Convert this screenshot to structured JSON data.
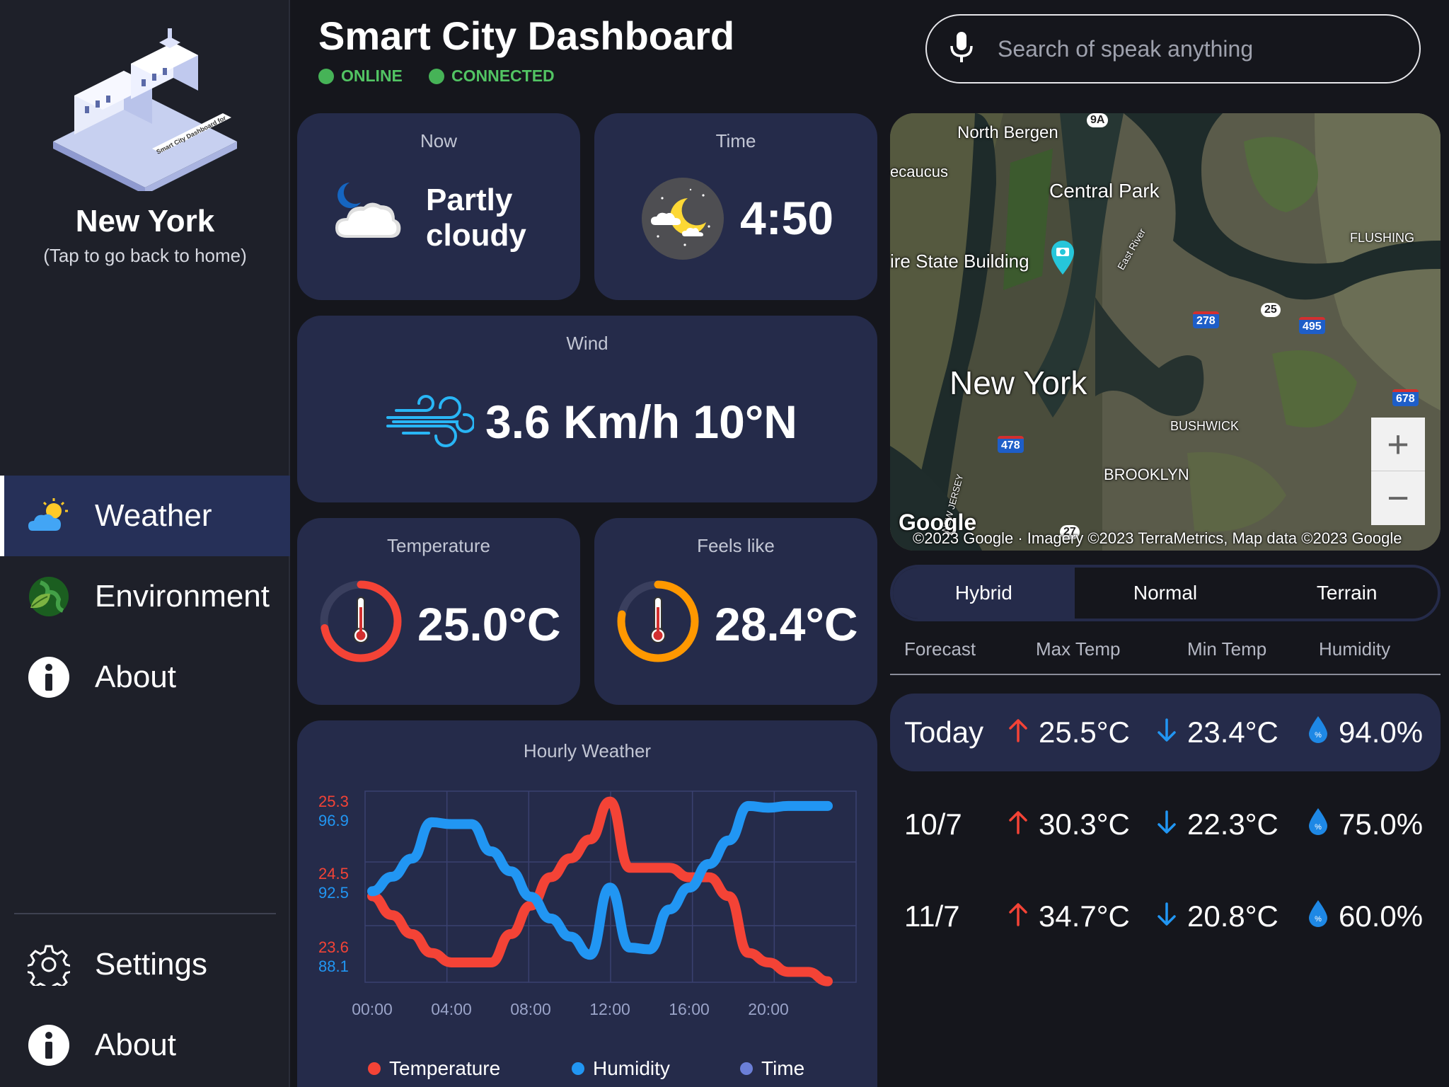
{
  "sidebar": {
    "city": "New York",
    "city_hint": "(Tap to go back to home)",
    "illustration_text": "Smart City Dashboard for",
    "nav": [
      {
        "label": "Weather",
        "icon": "weather-icon",
        "active": true
      },
      {
        "label": "Environment",
        "icon": "globe-leaf-icon"
      },
      {
        "label": "About",
        "icon": "info-icon"
      }
    ],
    "bottom": [
      {
        "label": "Settings",
        "icon": "gear-icon"
      },
      {
        "label": "About",
        "icon": "info-icon"
      }
    ]
  },
  "header": {
    "title": "Smart City Dashboard",
    "status_online": "ONLINE",
    "status_connected": "CONNECTED",
    "search_placeholder": "Search of speak anything"
  },
  "cards": {
    "now": {
      "title": "Now",
      "line1": "Partly",
      "line2": "cloudy",
      "icon": "partly-cloudy-night-icon"
    },
    "time": {
      "title": "Time",
      "value": "4:50",
      "icon": "moon-cloud-icon"
    },
    "wind": {
      "title": "Wind",
      "value": "3.6 Km/h 10°N",
      "icon": "wind-icon"
    },
    "temperature": {
      "title": "Temperature",
      "value": "25.0°C",
      "gauge_fraction": 0.72,
      "color": "#f44336"
    },
    "feels_like": {
      "title": "Feels like",
      "value": "28.4°C",
      "gauge_fraction": 0.78,
      "color": "#ff9800"
    }
  },
  "map": {
    "labels": {
      "north_bergen": "North Bergen",
      "secaucus": "ecaucus",
      "central_park": "Central Park",
      "empire": "ire State Building",
      "flushing": "FLUSHING",
      "east_river": "East River",
      "new_york": "New York",
      "bushwick": "BUSHWICK",
      "brooklyn": "BROOKLYN",
      "new_jersey": "NEW JERSEY"
    },
    "highways": {
      "h9a": "9A",
      "h278": "278",
      "h25": "25",
      "h495": "495",
      "h678": "678",
      "h478": "478",
      "h27": "27"
    },
    "logo": "Google",
    "attribution": "©2023 Google · Imagery ©2023 TerraMetrics, Map data ©2023 Google",
    "zoom_in": "+",
    "zoom_out": "−",
    "modes": [
      "Hybrid",
      "Normal",
      "Terrain"
    ],
    "active_mode": "Hybrid"
  },
  "forecast": {
    "headers": [
      "Forecast",
      "Max Temp",
      "Min Temp",
      "Humidity"
    ],
    "rows": [
      {
        "day": "Today",
        "max": "25.5°C",
        "min": "23.4°C",
        "humidity": "94.0%"
      },
      {
        "day": "10/7",
        "max": "30.3°C",
        "min": "22.3°C",
        "humidity": "75.0%"
      },
      {
        "day": "11/7",
        "max": "34.7°C",
        "min": "20.8°C",
        "humidity": "60.0%"
      }
    ]
  },
  "chart_data": {
    "type": "line",
    "title": "Hourly Weather",
    "x": [
      "00:00",
      "01:00",
      "02:00",
      "03:00",
      "04:00",
      "05:00",
      "06:00",
      "07:00",
      "08:00",
      "09:00",
      "10:00",
      "11:00",
      "12:00",
      "13:00",
      "14:00",
      "15:00",
      "16:00",
      "17:00",
      "18:00",
      "19:00",
      "20:00",
      "21:00",
      "22:00",
      "23:00"
    ],
    "x_ticks": [
      "00:00",
      "04:00",
      "08:00",
      "12:00",
      "16:00",
      "20:00"
    ],
    "series": [
      {
        "name": "Temperature",
        "axis": "left",
        "color": "#f44336",
        "values": [
          24.3,
          24.1,
          23.9,
          23.7,
          23.6,
          23.6,
          23.6,
          23.9,
          24.2,
          24.5,
          24.7,
          24.9,
          25.3,
          24.6,
          24.6,
          24.6,
          24.5,
          24.5,
          24.3,
          23.7,
          23.6,
          23.5,
          23.5,
          23.4
        ]
      },
      {
        "name": "Humidity",
        "axis": "right",
        "color": "#2196f3",
        "values": [
          92.4,
          93.2,
          94.2,
          96.2,
          96.1,
          96.1,
          94.6,
          93.5,
          92.1,
          90.9,
          89.9,
          88.9,
          92.6,
          89.3,
          89.2,
          91.4,
          92.6,
          93.9,
          95.2,
          97.1,
          97.0,
          97.1,
          97.1,
          97.1
        ]
      },
      {
        "name": "Time",
        "color": "#6b7fd7",
        "values": []
      }
    ],
    "left_ticks": [
      "25.3",
      "24.5",
      "23.6"
    ],
    "right_ticks": [
      "96.9",
      "92.5",
      "88.1"
    ],
    "left_range": [
      23.45,
      25.35
    ],
    "right_range": [
      87.7,
      97.6
    ],
    "grid": true,
    "legend_position": "bottom"
  }
}
